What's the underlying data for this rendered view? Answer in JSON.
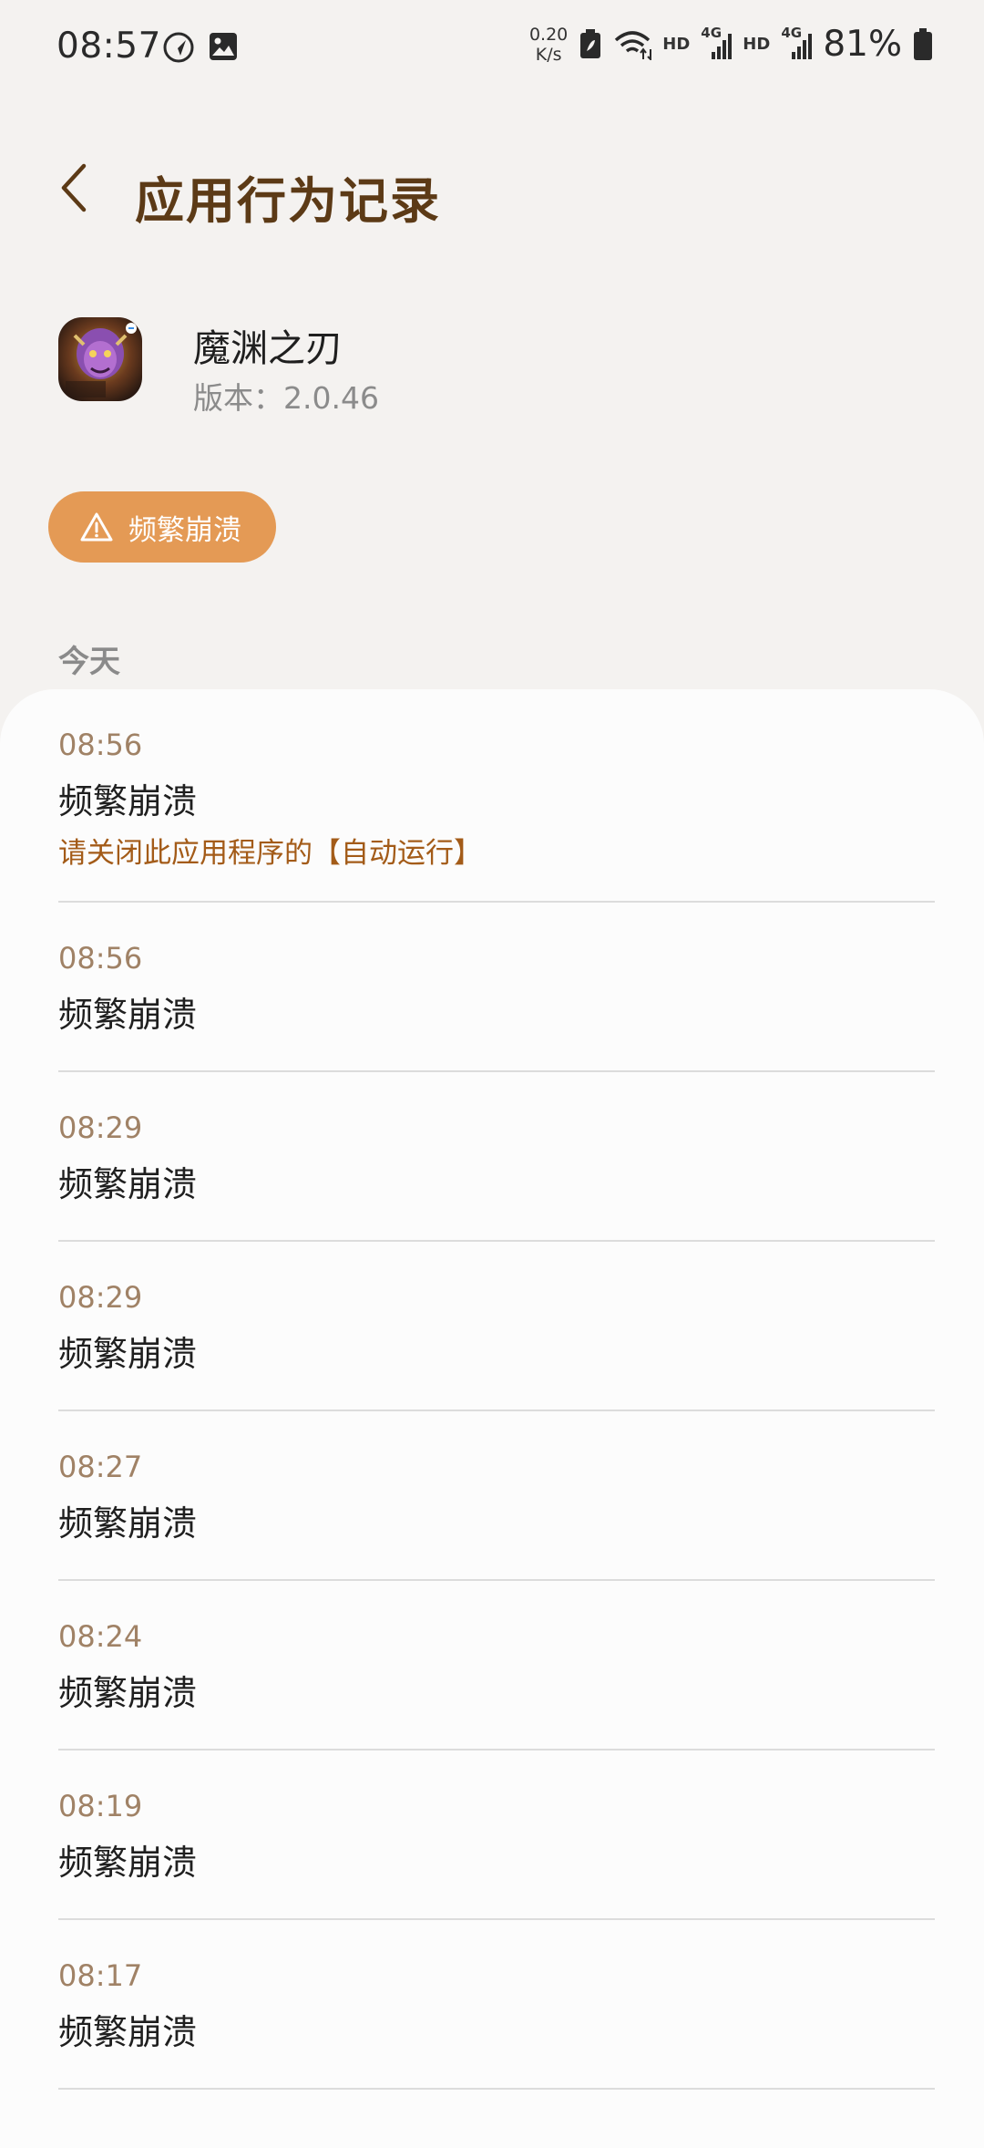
{
  "status_bar": {
    "time": "08:57",
    "net_speed_value": "0.20",
    "net_speed_unit": "K/s",
    "hd1": "HD",
    "hd2": "HD",
    "sig1": "4G",
    "sig2": "4G",
    "battery": "81%",
    "icons": [
      "navigation-icon",
      "gallery-icon",
      "battery-saver-icon",
      "wifi-icon",
      "signal-icon",
      "battery-icon"
    ]
  },
  "header": {
    "title": "应用行为记录",
    "back_icon": "chevron-left-icon"
  },
  "app": {
    "name": "魔渊之刃",
    "version": "版本：2.0.46"
  },
  "warning_chip": {
    "label": "频繁崩溃",
    "icon": "warning-triangle-icon",
    "color": "#e49a55"
  },
  "section": {
    "label": "今天"
  },
  "records": [
    {
      "time": "08:56",
      "title": "频繁崩溃",
      "hint": "请关闭此应用程序的【自动运行】"
    },
    {
      "time": "08:56",
      "title": "频繁崩溃"
    },
    {
      "time": "08:29",
      "title": "频繁崩溃"
    },
    {
      "time": "08:29",
      "title": "频繁崩溃"
    },
    {
      "time": "08:27",
      "title": "频繁崩溃"
    },
    {
      "time": "08:24",
      "title": "频繁崩溃"
    },
    {
      "time": "08:19",
      "title": "频繁崩溃"
    },
    {
      "time": "08:17",
      "title": "频繁崩溃"
    }
  ],
  "colors": {
    "background": "#f4f2f0",
    "title": "#5c3a16",
    "time": "#a08266",
    "hint": "#a35b18"
  }
}
